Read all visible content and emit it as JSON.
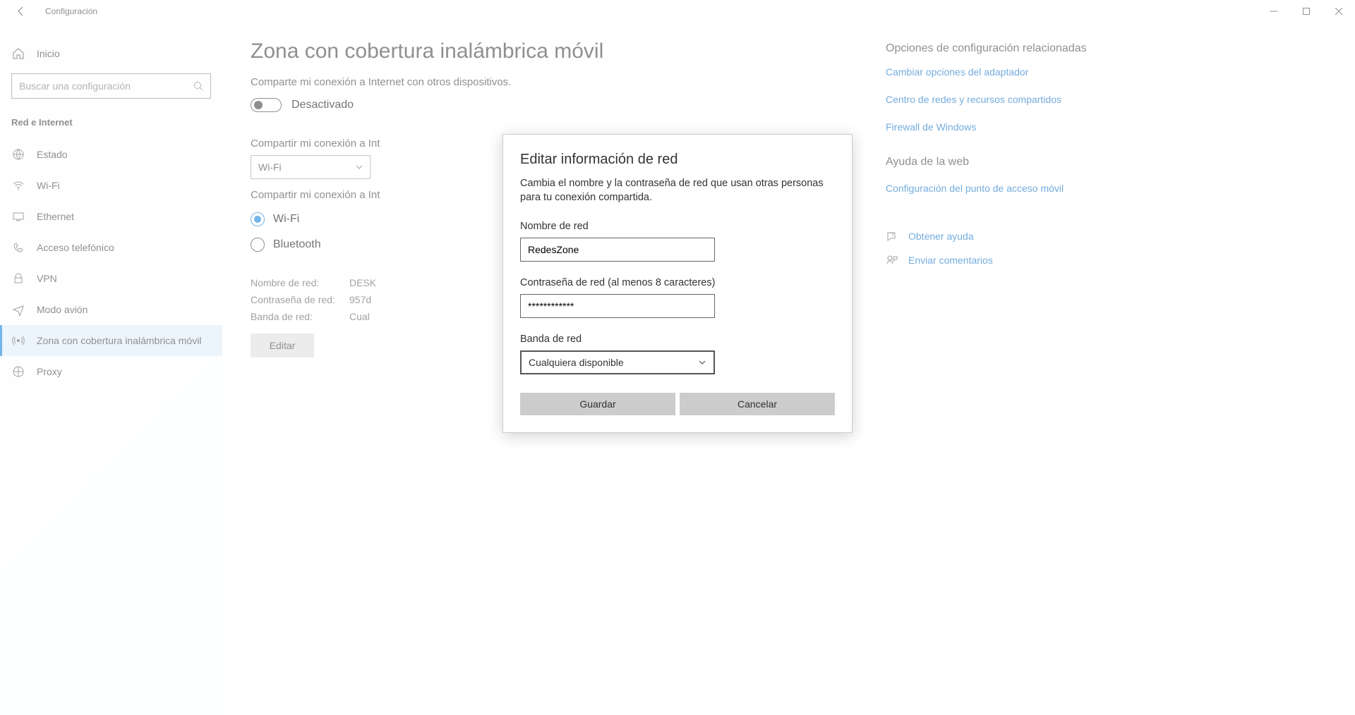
{
  "titlebar": {
    "title": "Configuración"
  },
  "sidebar": {
    "home": "Inicio",
    "search_placeholder": "Buscar una configuración",
    "section_title": "Red e Internet",
    "items": [
      {
        "label": "Estado"
      },
      {
        "label": "Wi-Fi"
      },
      {
        "label": "Ethernet"
      },
      {
        "label": "Acceso telefónico"
      },
      {
        "label": "VPN"
      },
      {
        "label": "Modo avión"
      },
      {
        "label": "Zona con cobertura inalámbrica móvil"
      },
      {
        "label": "Proxy"
      }
    ]
  },
  "main": {
    "title": "Zona con cobertura inalámbrica móvil",
    "share_desc": "Comparte mi conexión a Internet con otros dispositivos.",
    "toggle_state": "Desactivado",
    "share_from_label": "Compartir mi conexión a Int",
    "share_from_value": "Wi-Fi",
    "share_via_label": "Compartir mi conexión a Int",
    "radio_wifi": "Wi-Fi",
    "radio_bt": "Bluetooth",
    "info": {
      "name_label": "Nombre de red:",
      "name_value": "DESK",
      "pass_label": "Contraseña de red:",
      "pass_value": "957d",
      "band_label": "Banda de red:",
      "band_value": "Cual"
    },
    "edit_button": "Editar"
  },
  "dialog": {
    "title": "Editar información de red",
    "desc": "Cambia el nombre y la contraseña de red que usan otras personas para tu conexión compartida.",
    "name_label": "Nombre de red",
    "name_value": "RedesZone",
    "pass_label": "Contraseña de red (al menos 8 caracteres)",
    "pass_value": "************",
    "band_label": "Banda de red",
    "band_value": "Cualquiera disponible",
    "save": "Guardar",
    "cancel": "Cancelar"
  },
  "right": {
    "related_heading": "Opciones de configuración relacionadas",
    "links": [
      "Cambiar opciones del adaptador",
      "Centro de redes y recursos compartidos",
      "Firewall de Windows"
    ],
    "help_heading": "Ayuda de la web",
    "help_link": "Configuración del punto de acceso móvil",
    "get_help": "Obtener ayuda",
    "feedback": "Enviar comentarios"
  }
}
